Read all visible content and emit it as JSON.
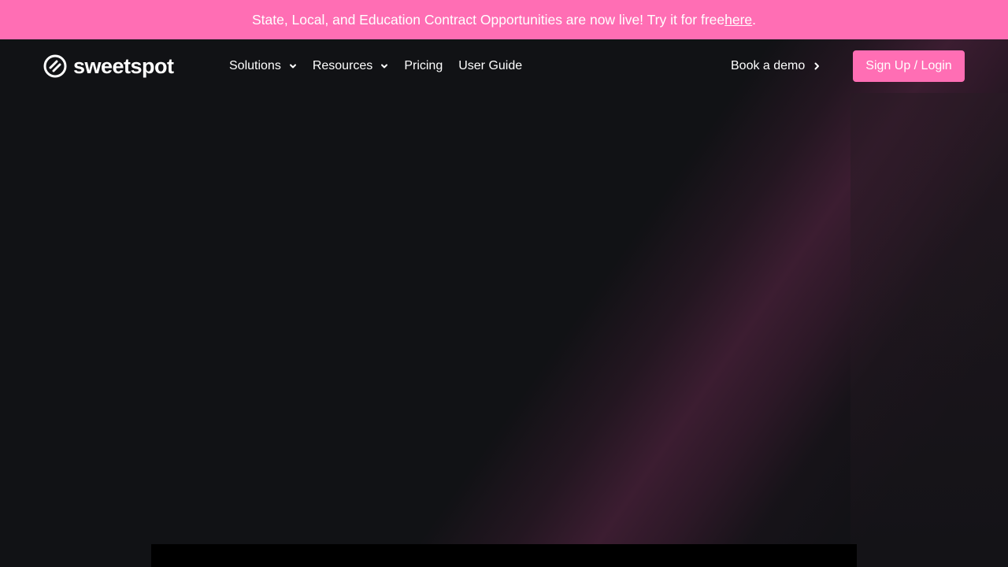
{
  "banner": {
    "text": "State, Local, and Education Contract Opportunities are now live! Try it for free ",
    "link": "here",
    "suffix": "."
  },
  "brand": {
    "name": "sweetspot",
    "logo_icon": "sweetspot-logo-icon"
  },
  "nav": {
    "items": [
      {
        "label": "Solutions",
        "has_dropdown": true
      },
      {
        "label": "Resources",
        "has_dropdown": true
      },
      {
        "label": "Pricing",
        "has_dropdown": false
      },
      {
        "label": "User Guide",
        "has_dropdown": false
      }
    ],
    "demo_label": "Book a demo",
    "signup_label": "Sign Up / Login"
  },
  "colors": {
    "accent": "#ff6eb4",
    "background": "#111215",
    "text": "#ffffff"
  }
}
